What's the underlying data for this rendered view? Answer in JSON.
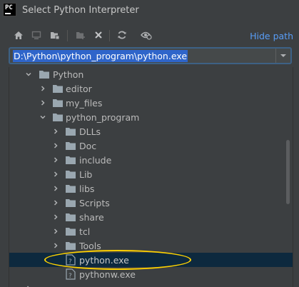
{
  "window": {
    "title": "Select Python Interpreter",
    "logo_text": "PC"
  },
  "toolbar": {
    "buttons": [
      {
        "name": "home-directory-button",
        "icon": "home-icon"
      },
      {
        "name": "desktop-button",
        "icon": "desktop-icon"
      },
      {
        "name": "project-directory-button",
        "icon": "project-folder-icon"
      },
      {
        "name": "new-folder-button",
        "icon": "new-folder-icon"
      },
      {
        "name": "delete-button",
        "icon": "close-icon"
      },
      {
        "name": "refresh-button",
        "icon": "refresh-icon"
      },
      {
        "name": "show-hidden-button",
        "icon": "show-hidden-icon"
      }
    ],
    "hide_path_label": "Hide path"
  },
  "path": {
    "value": "D:\\Python\\python_program\\python.exe"
  },
  "tree": [
    {
      "label": "Python"
    },
    {
      "label": "editor"
    },
    {
      "label": "my_files"
    },
    {
      "label": "python_program"
    },
    {
      "label": "DLLs"
    },
    {
      "label": "Doc"
    },
    {
      "label": "include"
    },
    {
      "label": "Lib"
    },
    {
      "label": "libs"
    },
    {
      "label": "Scripts"
    },
    {
      "label": "share"
    },
    {
      "label": "tcl"
    },
    {
      "label": "Tools"
    },
    {
      "label": "python.exe",
      "selected": true
    },
    {
      "label": "pythonw.exe"
    }
  ],
  "colors": {
    "background": "#3c3f41",
    "selection": "#0d293e",
    "link": "#589df6",
    "folder": "#9aa7b0",
    "highlight": "#ffd200"
  }
}
